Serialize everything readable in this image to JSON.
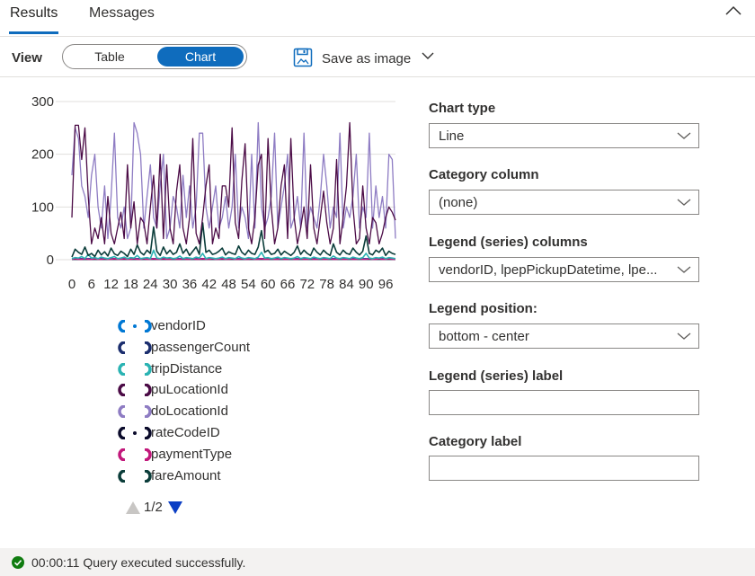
{
  "tabs": [
    {
      "label": "Results"
    },
    {
      "label": "Messages"
    }
  ],
  "toolbar": {
    "view_label": "View",
    "view_options": [
      "Table",
      "Chart"
    ],
    "selected_view": "Chart",
    "save_label": "Save as image"
  },
  "chart_data": {
    "type": "line",
    "title": "",
    "xlabel": "",
    "ylabel": "",
    "ylim": [
      0,
      300
    ],
    "yticks": [
      "300",
      "200",
      "100",
      "0"
    ],
    "xticks": [
      "0",
      "6",
      "12",
      "18",
      "24",
      "30",
      "36",
      "42",
      "48",
      "54",
      "60",
      "66",
      "72",
      "78",
      "84",
      "90",
      "96"
    ],
    "x_range": [
      0,
      99
    ],
    "grid": "horizontal",
    "legend_position": "bottom - center",
    "series": [
      {
        "name": "vendorID",
        "color": "#0078d4",
        "values": [
          2,
          2,
          2,
          2,
          2,
          2,
          2,
          2,
          2,
          2,
          2,
          2,
          2,
          2,
          2,
          2,
          2,
          2,
          2,
          2,
          2,
          2,
          2,
          2,
          2,
          2,
          2,
          2,
          2,
          2,
          2,
          2,
          2,
          2,
          2,
          2,
          2,
          2,
          2,
          2,
          2,
          2,
          2,
          2,
          2,
          2,
          2,
          2,
          2,
          2,
          2,
          2,
          2,
          2,
          2,
          2,
          2,
          2,
          2,
          2,
          2,
          2,
          2,
          2,
          2,
          2,
          2,
          2,
          2,
          2,
          2,
          2,
          2,
          2,
          2,
          2,
          2,
          2,
          2,
          2,
          2,
          2,
          2,
          2,
          2,
          2,
          2,
          2,
          2,
          2,
          2,
          2,
          2,
          2,
          2,
          2,
          2,
          2,
          2,
          2
        ]
      },
      {
        "name": "passengerCount",
        "color": "#1b2e6e",
        "values": [
          1,
          1,
          1,
          1,
          1,
          1,
          1,
          1,
          1,
          1,
          1,
          1,
          1,
          1,
          1,
          1,
          1,
          1,
          1,
          1,
          1,
          1,
          1,
          1,
          1,
          1,
          1,
          1,
          1,
          1,
          1,
          1,
          1,
          1,
          1,
          1,
          1,
          1,
          1,
          1,
          1,
          1,
          1,
          1,
          1,
          1,
          1,
          1,
          1,
          1,
          1,
          1,
          1,
          1,
          1,
          1,
          1,
          1,
          1,
          1,
          1,
          1,
          1,
          1,
          1,
          1,
          1,
          1,
          1,
          1,
          1,
          1,
          1,
          1,
          1,
          1,
          1,
          1,
          1,
          1,
          1,
          1,
          1,
          1,
          1,
          1,
          1,
          1,
          1,
          1,
          1,
          1,
          1,
          1,
          1,
          1,
          1,
          1,
          1,
          1
        ]
      },
      {
        "name": "tripDistance",
        "color": "#2ab3b3",
        "values": [
          2,
          4,
          3,
          6,
          2,
          10,
          3,
          4,
          2,
          5,
          3,
          2,
          4,
          6,
          2,
          3,
          5,
          2,
          4,
          3,
          8,
          2,
          3,
          4,
          2,
          18,
          3,
          2,
          5,
          3,
          4,
          2,
          3,
          7,
          2,
          4,
          3,
          2,
          5,
          3,
          12,
          2,
          4,
          3,
          2,
          3,
          5,
          2,
          4,
          3,
          2,
          6,
          3,
          2,
          4,
          3,
          2,
          5,
          14,
          3,
          4,
          2,
          3,
          5,
          2,
          4,
          3,
          2,
          3,
          6,
          2,
          4,
          3,
          2,
          5,
          3,
          2,
          4,
          3,
          2,
          7,
          3,
          2,
          4,
          3,
          2,
          5,
          3,
          2,
          4,
          12,
          3,
          2,
          4,
          3,
          5,
          2,
          4,
          3,
          2
        ]
      },
      {
        "name": "puLocationId",
        "color": "#4b0b46",
        "values": [
          80,
          255,
          255,
          190,
          250,
          120,
          30,
          60,
          40,
          80,
          30,
          120,
          50,
          30,
          60,
          90,
          40,
          180,
          60,
          110,
          30,
          80,
          70,
          30,
          100,
          160,
          60,
          200,
          40,
          180,
          60,
          30,
          130,
          180,
          60,
          30,
          80,
          230,
          50,
          30,
          80,
          140,
          180,
          30,
          60,
          40,
          140,
          140,
          100,
          250,
          70,
          40,
          150,
          220,
          60,
          30,
          80,
          180,
          200,
          40,
          230,
          100,
          30,
          60,
          140,
          180,
          40,
          230,
          80,
          30,
          60,
          100,
          40,
          180,
          60,
          30,
          80,
          130,
          70,
          30,
          60,
          190,
          30,
          80,
          140,
          260,
          100,
          30,
          40,
          140,
          60,
          30,
          80,
          70,
          30,
          50,
          80,
          100,
          90,
          75
        ]
      },
      {
        "name": "doLocationId",
        "color": "#8e7cc3",
        "values": [
          160,
          250,
          230,
          140,
          120,
          80,
          160,
          200,
          100,
          60,
          140,
          40,
          120,
          240,
          80,
          60,
          100,
          40,
          60,
          260,
          240,
          200,
          60,
          120,
          180,
          80,
          60,
          140,
          200,
          40,
          60,
          120,
          100,
          60,
          160,
          80,
          140,
          60,
          100,
          240,
          240,
          100,
          60,
          100,
          140,
          60,
          80,
          120,
          60,
          100,
          200,
          60,
          100,
          80,
          40,
          200,
          60,
          260,
          100,
          60,
          80,
          120,
          240,
          60,
          100,
          140,
          200,
          60,
          80,
          120,
          60,
          240,
          60,
          100,
          80,
          60,
          120,
          200,
          140,
          60,
          100,
          80,
          240,
          60,
          100,
          80,
          120,
          200,
          60,
          100,
          80,
          240,
          60,
          140,
          80,
          120,
          60,
          200,
          190,
          40
        ]
      },
      {
        "name": "rateCodeID",
        "color": "#0a0a2a",
        "values": [
          1,
          1,
          1,
          1,
          1,
          1,
          1,
          1,
          1,
          1,
          1,
          1,
          1,
          1,
          1,
          1,
          1,
          1,
          1,
          1,
          1,
          1,
          1,
          1,
          1,
          1,
          1,
          1,
          1,
          1,
          1,
          1,
          1,
          1,
          1,
          1,
          1,
          1,
          1,
          1,
          1,
          1,
          1,
          1,
          1,
          1,
          1,
          1,
          1,
          1,
          1,
          1,
          1,
          1,
          1,
          1,
          1,
          1,
          1,
          1,
          1,
          1,
          1,
          1,
          1,
          1,
          1,
          1,
          1,
          1,
          1,
          1,
          1,
          1,
          1,
          1,
          1,
          1,
          1,
          1,
          1,
          1,
          1,
          1,
          1,
          1,
          1,
          1,
          1,
          1,
          1,
          1,
          1,
          1,
          1,
          1,
          1,
          1,
          1,
          1
        ]
      },
      {
        "name": "paymentType",
        "color": "#c2187b",
        "values": [
          1,
          2,
          1,
          1,
          2,
          1,
          1,
          2,
          1,
          1,
          2,
          1,
          1,
          2,
          1,
          1,
          2,
          1,
          1,
          2,
          1,
          1,
          2,
          1,
          1,
          2,
          1,
          1,
          2,
          1,
          1,
          2,
          1,
          1,
          2,
          1,
          1,
          2,
          1,
          1,
          2,
          1,
          1,
          2,
          1,
          1,
          2,
          1,
          1,
          2,
          1,
          1,
          2,
          1,
          1,
          2,
          1,
          1,
          2,
          1,
          1,
          2,
          1,
          1,
          2,
          1,
          1,
          2,
          1,
          1,
          2,
          1,
          1,
          2,
          1,
          1,
          2,
          1,
          1,
          2,
          1,
          1,
          2,
          1,
          1,
          2,
          1,
          1,
          2,
          1,
          1,
          2,
          1,
          1,
          2,
          1,
          1,
          2,
          1,
          1
        ]
      },
      {
        "name": "fareAmount",
        "color": "#0b3d3a",
        "values": [
          5,
          20,
          14,
          10,
          24,
          8,
          12,
          6,
          18,
          9,
          15,
          7,
          22,
          11,
          8,
          16,
          12,
          6,
          20,
          10,
          28,
          14,
          9,
          18,
          12,
          62,
          16,
          8,
          24,
          11,
          18,
          10,
          14,
          30,
          12,
          20,
          8,
          16,
          24,
          10,
          70,
          14,
          18,
          10,
          12,
          16,
          22,
          9,
          15,
          12,
          10,
          26,
          14,
          9,
          18,
          12,
          10,
          24,
          55,
          14,
          18,
          10,
          12,
          20,
          9,
          16,
          12,
          8,
          14,
          26,
          10,
          18,
          12,
          8,
          22,
          14,
          9,
          18,
          12,
          8,
          30,
          14,
          9,
          18,
          12,
          10,
          22,
          14,
          9,
          16,
          45,
          12,
          9,
          18,
          14,
          22,
          8,
          16,
          12,
          10
        ]
      }
    ]
  },
  "legend": {
    "items": [
      {
        "name": "vendorID",
        "color": "#0078d4"
      },
      {
        "name": "passengerCount",
        "color": "#1b2e6e"
      },
      {
        "name": "tripDistance",
        "color": "#2ab3b3"
      },
      {
        "name": "puLocationId",
        "color": "#4b0b46"
      },
      {
        "name": "doLocationId",
        "color": "#8e7cc3"
      },
      {
        "name": "rateCodeID",
        "color": "#0a0a2a"
      },
      {
        "name": "paymentType",
        "color": "#c2187b"
      },
      {
        "name": "fareAmount",
        "color": "#0b3d3a"
      }
    ],
    "pager": "1/2"
  },
  "properties": {
    "chart_type_label": "Chart type",
    "chart_type_value": "Line",
    "category_column_label": "Category column",
    "category_column_value": "(none)",
    "legend_columns_label": "Legend (series) columns",
    "legend_columns_value": "vendorID, lpepPickupDatetime, lpe...",
    "legend_position_label": "Legend position:",
    "legend_position_value": "bottom - center",
    "legend_series_label_label": "Legend (series) label",
    "legend_series_label_value": "",
    "category_label_label": "Category label",
    "category_label_value": ""
  },
  "status": {
    "text": "00:00:11 Query executed successfully."
  }
}
